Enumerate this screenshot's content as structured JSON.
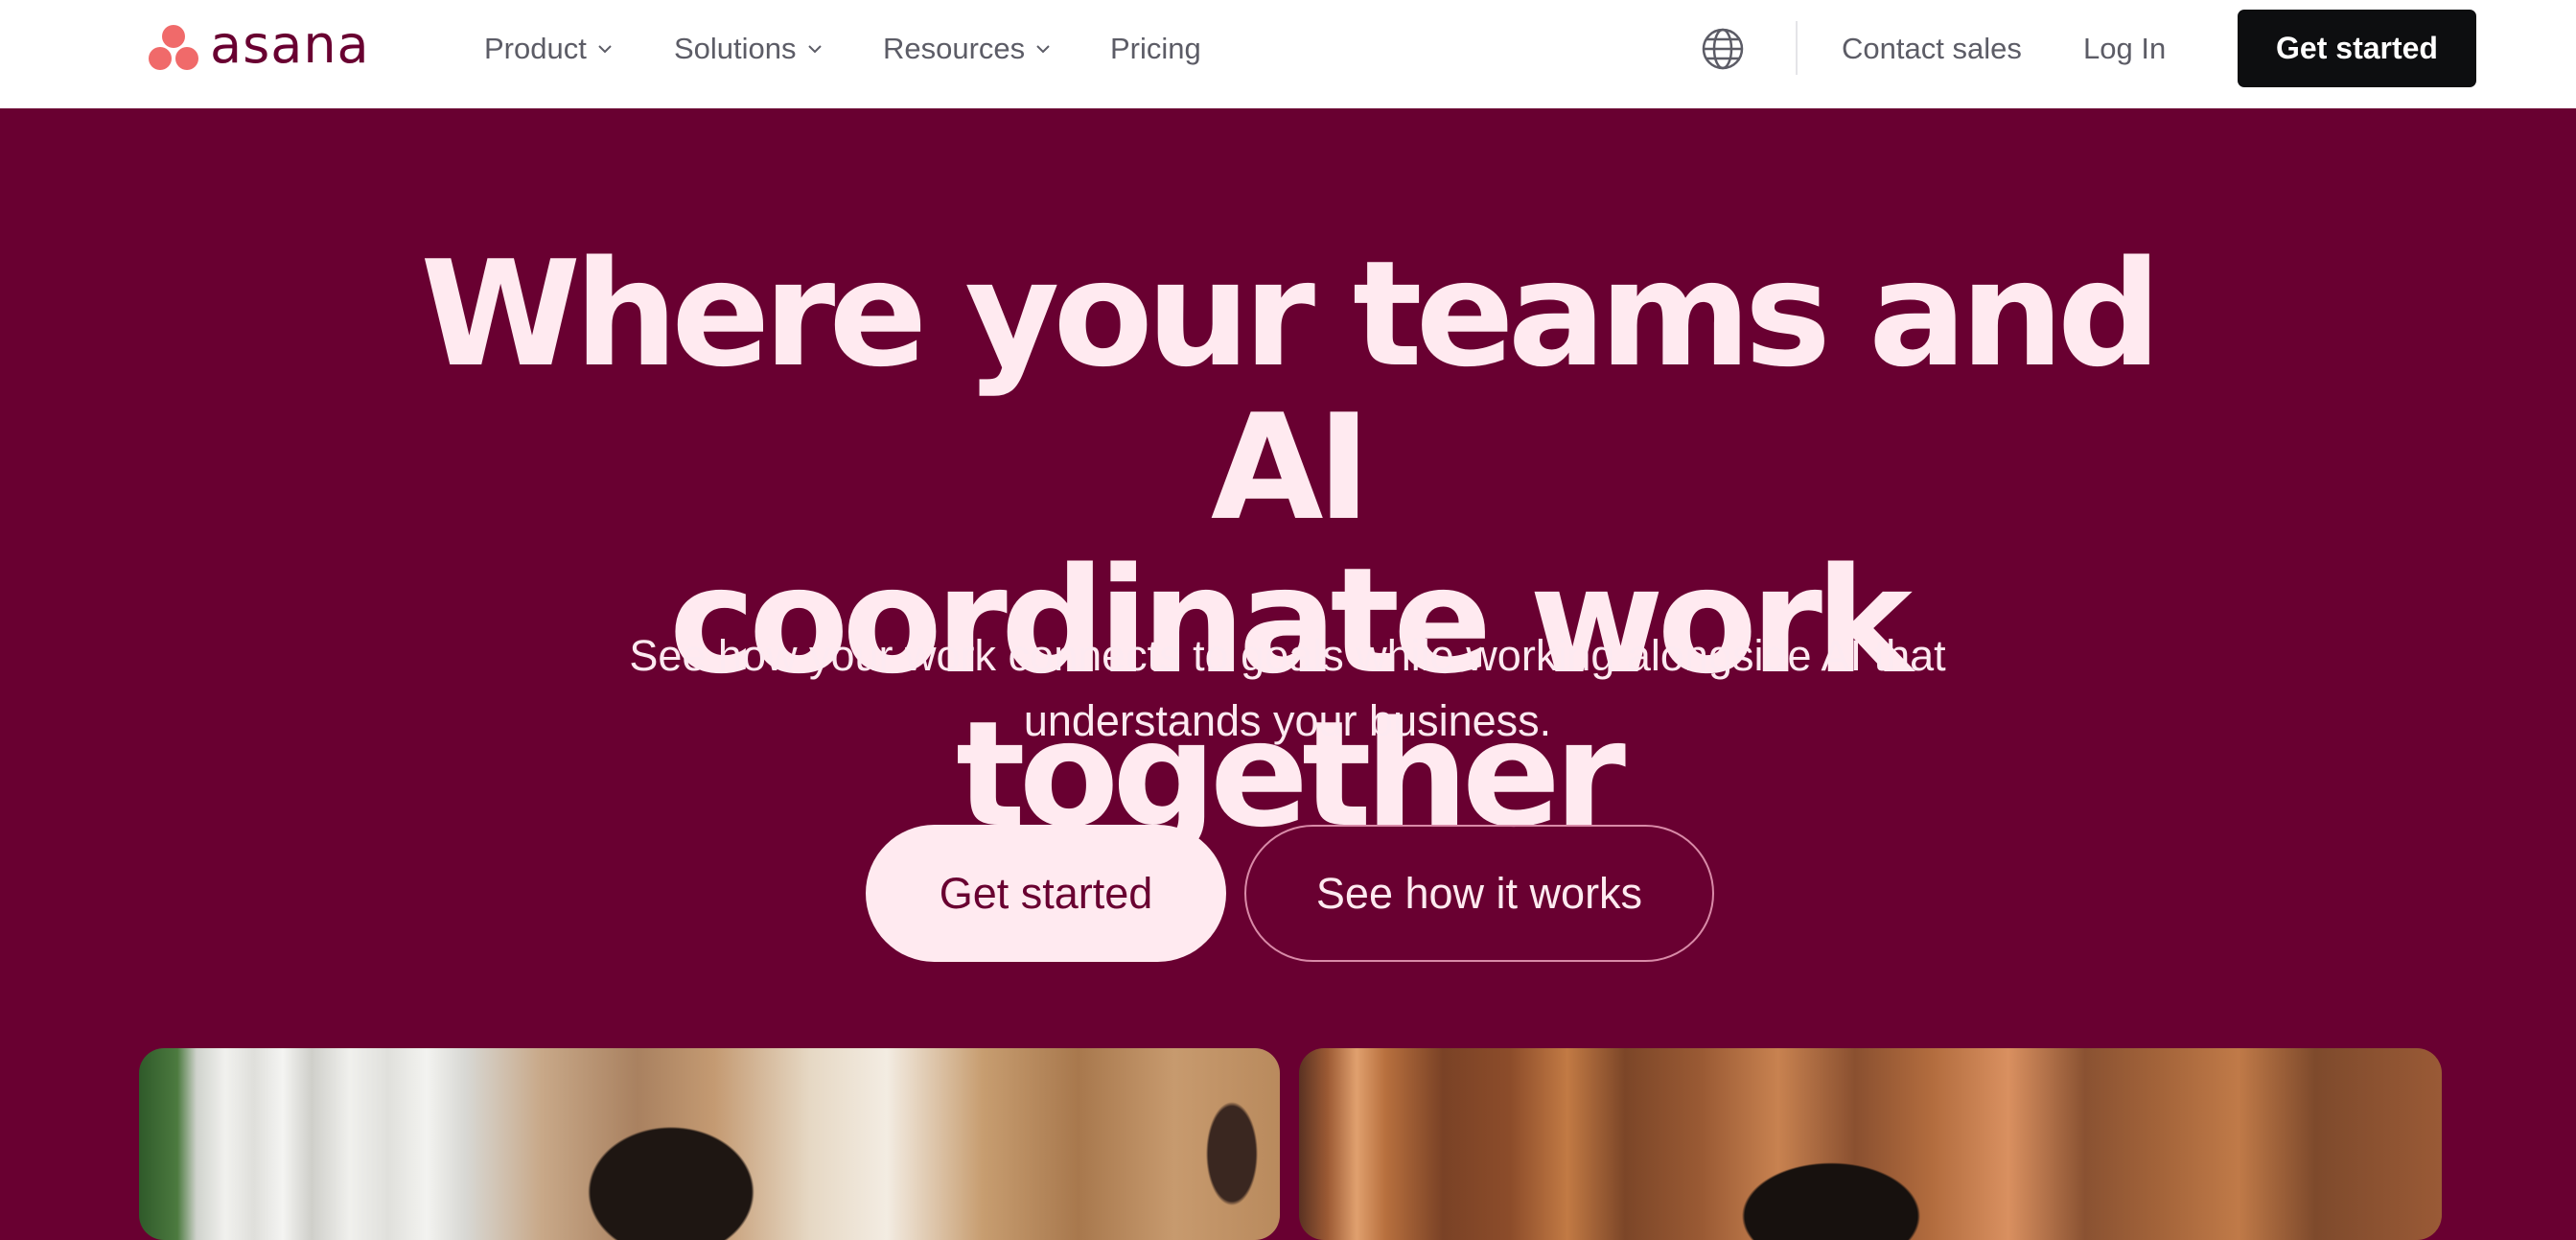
{
  "brand": {
    "name": "asana",
    "dot_color": "#f06a6a"
  },
  "nav": {
    "items": [
      {
        "label": "Product",
        "has_dropdown": true
      },
      {
        "label": "Solutions",
        "has_dropdown": true
      },
      {
        "label": "Resources",
        "has_dropdown": true
      },
      {
        "label": "Pricing",
        "has_dropdown": false
      }
    ],
    "language_icon": "globe-icon",
    "contact_label": "Contact sales",
    "login_label": "Log In",
    "cta_label": "Get started"
  },
  "hero": {
    "title_line1": "Where your teams and AI",
    "title_line2": "coordinate work together",
    "subtitle_line1": "See how your work connects to goals while working alongside AI that",
    "subtitle_line2": "understands your business.",
    "primary_cta": "Get started",
    "secondary_cta": "See how it works"
  },
  "colors": {
    "hero_background": "#690031",
    "hero_text": "#ffeaf0",
    "nav_background": "#ffffff",
    "cta_dark": "#0d0e10"
  }
}
